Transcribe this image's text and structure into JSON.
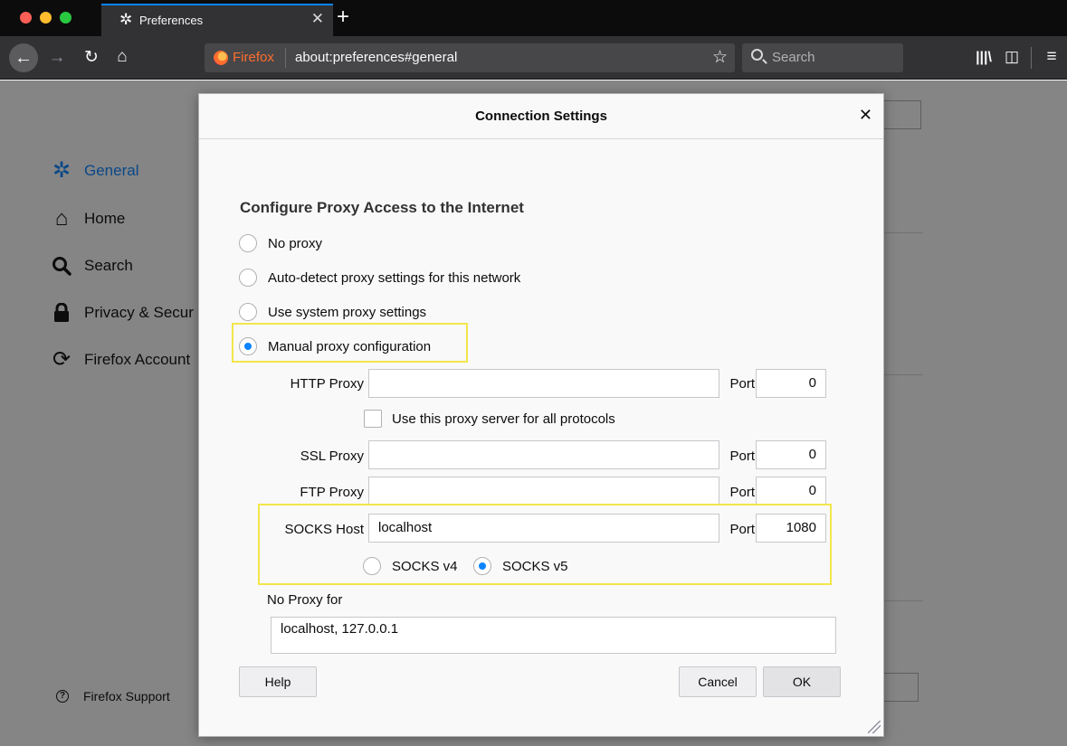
{
  "browser": {
    "tab_title": "Preferences",
    "identity": "Firefox",
    "url": "about:preferences#general",
    "search_placeholder": "Search"
  },
  "sidebar": {
    "items": [
      {
        "label": "General",
        "icon": "gear-icon",
        "active": true
      },
      {
        "label": "Home",
        "icon": "home-icon"
      },
      {
        "label": "Search",
        "icon": "search-icon"
      },
      {
        "label": "Privacy & Secur",
        "icon": "lock-icon"
      },
      {
        "label": "Firefox Account",
        "icon": "sync-icon"
      }
    ],
    "support_label": "Firefox Support"
  },
  "dialog": {
    "title": "Connection Settings",
    "heading": "Configure Proxy Access to the Internet",
    "proxy_options": [
      {
        "label": "No proxy",
        "selected": false
      },
      {
        "label": "Auto-detect proxy settings for this network",
        "selected": false
      },
      {
        "label": "Use system proxy settings",
        "selected": false
      },
      {
        "label": "Manual proxy configuration",
        "selected": true
      }
    ],
    "http_proxy": {
      "label": "HTTP Proxy",
      "value": "",
      "port_label": "Port",
      "port": "0"
    },
    "all_protocols_label": "Use this proxy server for all protocols",
    "ssl_proxy": {
      "label": "SSL Proxy",
      "value": "",
      "port_label": "Port",
      "port": "0"
    },
    "ftp_proxy": {
      "label": "FTP Proxy",
      "value": "",
      "port_label": "Port",
      "port": "0"
    },
    "socks_host": {
      "label": "SOCKS Host",
      "value": "localhost",
      "port_label": "Port",
      "port": "1080"
    },
    "socks_versions": [
      {
        "label": "SOCKS v4",
        "selected": false
      },
      {
        "label": "SOCKS v5",
        "selected": true
      }
    ],
    "no_proxy_label": "No Proxy for",
    "no_proxy_value": "localhost, 127.0.0.1",
    "help_label": "Help",
    "cancel_label": "Cancel",
    "ok_label": "OK"
  },
  "colors": {
    "accent": "#0a84ff",
    "highlight": "#f2e64a",
    "titlebar": "#0c0c0d",
    "toolbar": "#323234"
  }
}
